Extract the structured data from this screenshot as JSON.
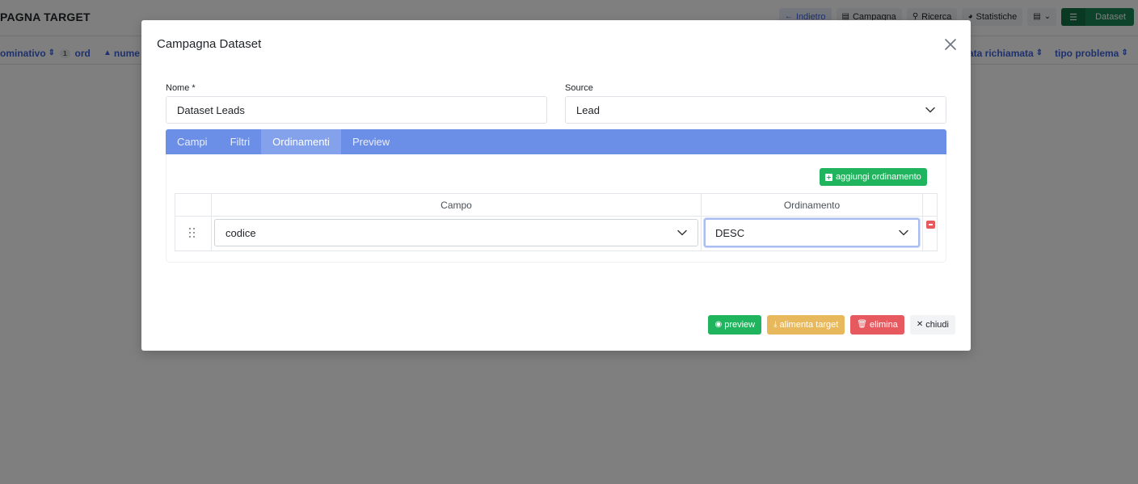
{
  "background": {
    "title": "PAGNA TARGET",
    "toolbar": {
      "back": "Indietro",
      "campagna": "Campagna",
      "ricerca": "Ricerca",
      "statistiche": "Statistiche",
      "dataset": "Dataset"
    },
    "columns": {
      "nominativo": "ominativo",
      "sort_badge": "1",
      "ord": "ord",
      "nume": "nume",
      "data_richiamata": "ata richiamata",
      "tipo_problema": "tipo problema"
    }
  },
  "modal": {
    "title": "Campagna Dataset",
    "nome": {
      "label": "Nome *",
      "value": "Dataset Leads"
    },
    "source": {
      "label": "Source",
      "value": "Lead"
    },
    "tabs": [
      {
        "label": "Campi",
        "active": false
      },
      {
        "label": "Filtri",
        "active": false
      },
      {
        "label": "Ordinamenti",
        "active": true
      },
      {
        "label": "Preview",
        "active": false
      }
    ],
    "add_button": "aggiungi ordinamento",
    "table": {
      "headers": {
        "campo": "Campo",
        "ordinamento": "Ordinamento"
      },
      "rows": [
        {
          "campo": "codice",
          "ordinamento": "DESC"
        }
      ]
    },
    "footer": {
      "preview": "preview",
      "alimenta": "alimenta target",
      "elimina": "elimina",
      "chiudi": "chiudi"
    }
  },
  "colors": {
    "tab_bar": "#6b8ee6",
    "success": "#20b45e",
    "warning": "#e8b85c",
    "danger": "#e65a5f",
    "link": "#3d63dd"
  }
}
